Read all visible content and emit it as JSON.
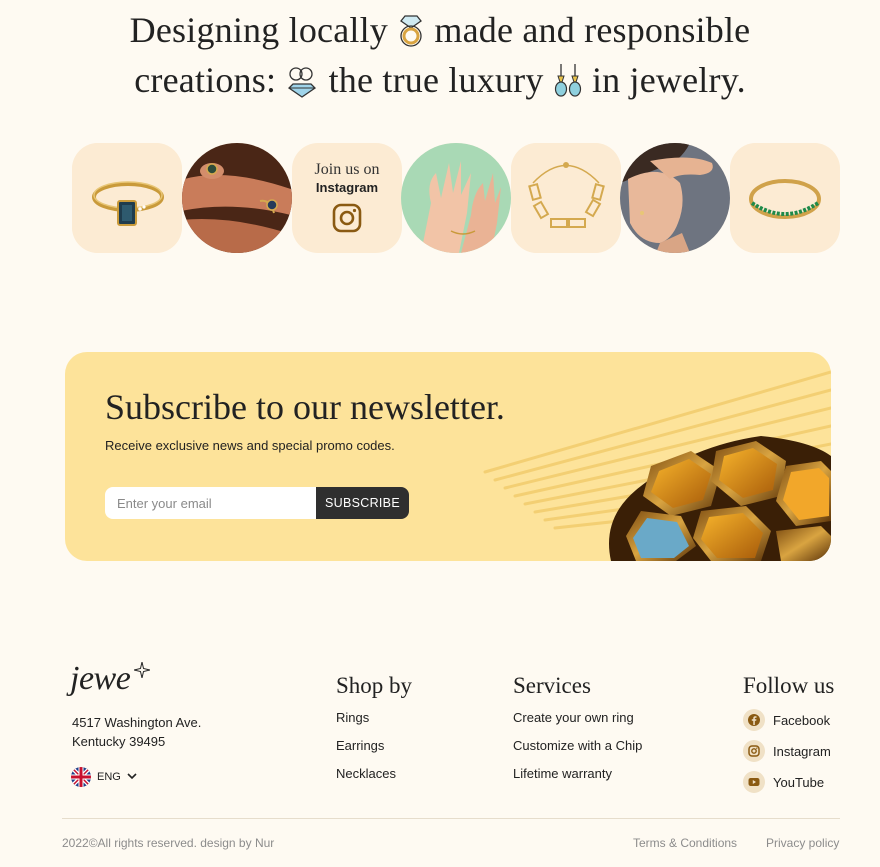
{
  "headline": {
    "line1_a": "Designing locally",
    "line1_b": "made and responsible",
    "line2_a": "creations:",
    "line2_b": "the true luxury",
    "line2_c": "in jewelry."
  },
  "instagram_tile": {
    "line1": "Join us on",
    "line2": "Instagram"
  },
  "newsletter": {
    "title": "Subscribe to our newsletter.",
    "subtitle": "Receive exclusive news and special promo codes.",
    "email_placeholder": "Enter your email",
    "button_label": "SUBSCRIBE"
  },
  "footer": {
    "logo": "jewe",
    "address_line1": "4517 Washington Ave.",
    "address_line2": "Kentucky 39495",
    "language": "ENG",
    "shop_by": {
      "title": "Shop by",
      "links": [
        "Rings",
        "Earrings",
        "Necklaces"
      ]
    },
    "services": {
      "title": "Services",
      "links": [
        "Create your own ring",
        "Customize with a Chip",
        "Lifetime warranty"
      ]
    },
    "follow_us": {
      "title": "Follow us",
      "links": [
        "Facebook",
        "Instagram",
        "YouTube"
      ]
    },
    "copyright": "2022©All rights reserved. design by Nur",
    "terms": "Terms & Conditions",
    "privacy": "Privacy policy"
  },
  "colors": {
    "background": "#fefaf2",
    "tile": "#fcebd3",
    "newsletter_bg": "#fde39a",
    "button_bg": "#2f2f2f",
    "accent_brown": "#8a5a12"
  }
}
